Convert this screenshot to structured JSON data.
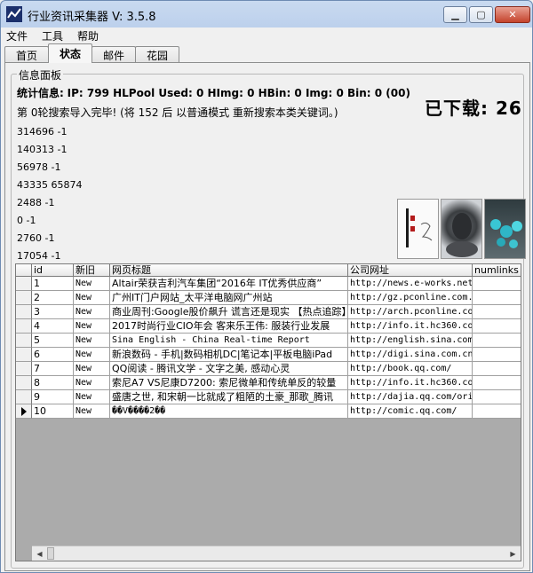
{
  "window": {
    "title": "行业资讯采集器 V: 3.5.8",
    "controls": {
      "minimize": "▁",
      "maximize": "▢",
      "close": "✕"
    }
  },
  "menu": {
    "items": [
      "文件",
      "工具",
      "帮助"
    ]
  },
  "tabs": [
    {
      "label": "首页",
      "active": false
    },
    {
      "label": "状态",
      "active": true
    },
    {
      "label": "邮件",
      "active": false
    },
    {
      "label": "花园",
      "active": false
    }
  ],
  "panel": {
    "legend": "信息面板",
    "stats_label": "统计信息:",
    "stats_values": "IP: 799 HLPool Used: 0 HImg: 0 HBin: 0 Img: 0 Bin: 0 (00)",
    "search_message": "第 0轮搜索导入完毕! (将 152 后 以普通模式 重新搜索本类关键词。)",
    "downloaded": "已下载: 26",
    "numbers": [
      "314696 -1",
      "140313 -1",
      "56978 -1",
      "43335 65874",
      "2488 -1",
      "0 -1",
      "2760 -1",
      "17054 -1"
    ]
  },
  "grid": {
    "columns": [
      "",
      "id",
      "新旧",
      "网页标题",
      "公司网址",
      "numlinks"
    ],
    "rows": [
      {
        "id": "1",
        "status": "New",
        "title": "Altair荣获吉利汽车集团“2016年 IT优秀供应商”",
        "url": "http://news.e-works.net",
        "numlinks": ""
      },
      {
        "id": "2",
        "status": "New",
        "title": "广州IT门户网站_太平洋电脑网广州站",
        "url": "http://gz.pconline.com.",
        "numlinks": ""
      },
      {
        "id": "3",
        "status": "New",
        "title": "商业周刊:Google股价飙升 谎言还是现实 【热点追踪】",
        "url": "http://arch.pconline.co",
        "numlinks": ""
      },
      {
        "id": "4",
        "status": "New",
        "title": "2017时尚行业CIO年会 客来乐王伟: 服装行业发展",
        "url": "http://info.it.hc360.co",
        "numlinks": ""
      },
      {
        "id": "5",
        "status": "New",
        "title": "Sina English - China Real-time Report",
        "url": "http://english.sina.com",
        "numlinks": ""
      },
      {
        "id": "6",
        "status": "New",
        "title": "新浪数码 - 手机|数码相机DC|笔记本|平板电脑iPad",
        "url": "http://digi.sina.com.cn",
        "numlinks": ""
      },
      {
        "id": "7",
        "status": "New",
        "title": "QQ阅读 - 腾讯文学 - 文字之美, 感动心灵",
        "url": "http://book.qq.com/",
        "numlinks": ""
      },
      {
        "id": "8",
        "status": "New",
        "title": "索尼A7 VS尼康D7200: 索尼微单和传统单反的较量",
        "url": "http://info.it.hc360.co",
        "numlinks": ""
      },
      {
        "id": "9",
        "status": "New",
        "title": "盛唐之世, 和宋朝一比就成了粗陋的土豪_那歌_腾讯",
        "url": "http://dajia.qq.com/ori",
        "numlinks": ""
      },
      {
        "id": "10",
        "status": "New",
        "title": "��V����2��",
        "url": "http://comic.qq.com/",
        "numlinks": ""
      }
    ],
    "current_row": "10"
  },
  "colors": {
    "title_gradient_top": "#c9daf0",
    "close_button": "#c4432c",
    "grid_background": "#ababab"
  }
}
